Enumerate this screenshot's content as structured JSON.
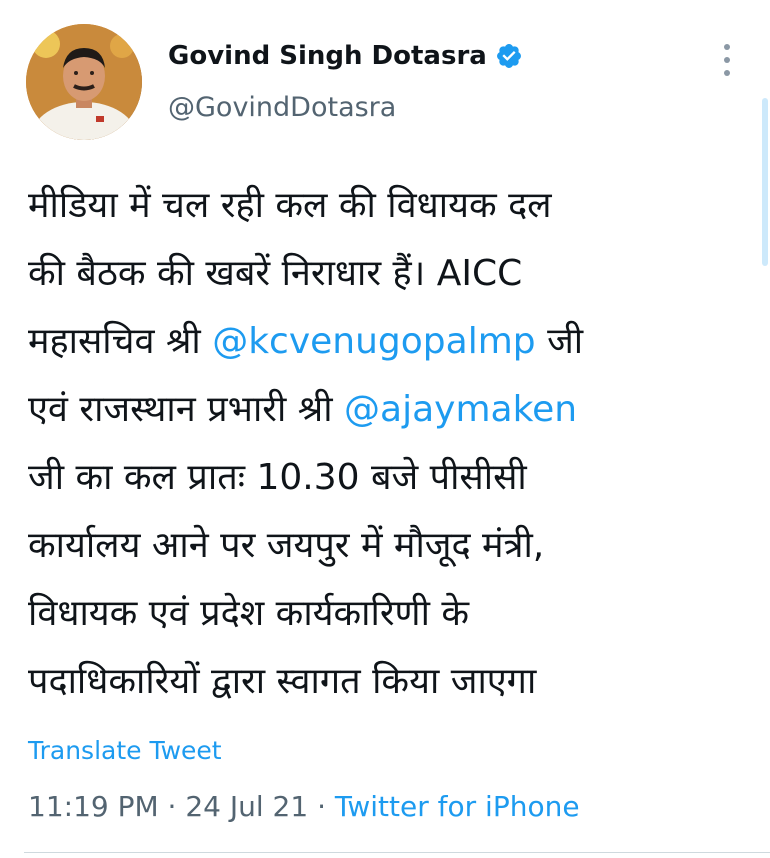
{
  "author": {
    "display_name": "Govind Singh Dotasra",
    "handle": "@GovindDotasra",
    "verified": true
  },
  "tweet": {
    "lines": [
      [
        {
          "t": "मीडिया में चल रही कल की विधायक दल",
          "m": false
        }
      ],
      [
        {
          "t": "की बैठक की खबरें निराधार हैं। AICC",
          "m": false
        }
      ],
      [
        {
          "t": "महासचिव श्री ",
          "m": false
        },
        {
          "t": "@kcvenugopalmp",
          "m": true
        },
        {
          "t": " जी",
          "m": false
        }
      ],
      [
        {
          "t": "एवं राजस्थान प्रभारी श्री ",
          "m": false
        },
        {
          "t": "@ajaymaken",
          "m": true
        }
      ],
      [
        {
          "t": "जी का कल प्रातः 10.30 बजे पीसीसी",
          "m": false
        }
      ],
      [
        {
          "t": "कार्यालय आने पर जयपुर में मौजूद मंत्री,",
          "m": false
        }
      ],
      [
        {
          "t": "विधायक एवं प्रदेश कार्यकारिणी के",
          "m": false
        }
      ],
      [
        {
          "t": "पदाधिकारियों द्वारा स्वागत किया जाएगा",
          "m": false
        }
      ]
    ],
    "translate_label": "Translate Tweet",
    "time": "11:19 PM",
    "separator": " · ",
    "date": "24 Jul 21",
    "source": "Twitter for iPhone"
  },
  "icons": {
    "verified": "verified-badge-icon",
    "more": "more-vertical-icon"
  },
  "colors": {
    "accent": "#1d9bf0",
    "text": "#0f1419",
    "secondary": "#536471"
  }
}
